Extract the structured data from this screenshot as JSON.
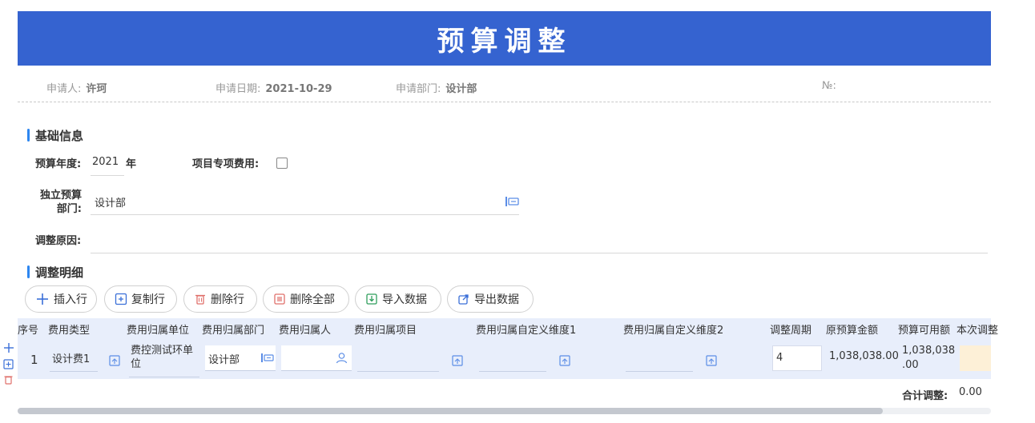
{
  "header": {
    "title": "预算调整"
  },
  "meta": {
    "applicant_label": "申请人:",
    "applicant_value": "许珂",
    "date_label": "申请日期:",
    "date_value": "2021-10-29",
    "dept_label": "申请部门:",
    "dept_value": "设计部",
    "no_label": "№:"
  },
  "basic_info": {
    "section_title": "基础信息",
    "year_label": "预算年度:",
    "year_value": "2021",
    "year_unit": "年",
    "project_fee_label": "项目专项费用:",
    "project_fee_checked": false,
    "independent_dept_label_line1": "独立预算",
    "independent_dept_label_line2": "部门:",
    "independent_dept_value": "设计部",
    "reason_label": "调整原因:"
  },
  "detail": {
    "section_title": "调整明细",
    "buttons": {
      "insert_row": "插入行",
      "copy_row": "复制行",
      "delete_row": "删除行",
      "delete_all": "删除全部",
      "import_data": "导入数据",
      "export_data": "导出数据"
    },
    "columns": {
      "seq": "序号",
      "fee_type": "费用类型",
      "unit": "费用归属单位",
      "dept": "费用归属部门",
      "person": "费用归属人",
      "project": "费用归属项目",
      "custom1": "费用归属自定义维度1",
      "custom2": "费用归属自定义维度2",
      "period": "调整周期",
      "original": "原预算金额",
      "available": "预算可用额",
      "current": "本次调整"
    },
    "row": {
      "seq": "1",
      "fee_type": "设计费1",
      "unit_line1": "费控测试环单",
      "unit_line2": "位",
      "dept": "设计部",
      "period": "4",
      "original": "1,038,038.00",
      "available_line1": "1,038,038",
      "available_line2": ".00"
    },
    "total_label": "合计调整:",
    "total_value": "0.00"
  },
  "colors": {
    "banner": "#3563d0",
    "accent": "#2d86f0",
    "row_bg": "#e8eefb",
    "adjust_cell": "#fdf0d7"
  }
}
